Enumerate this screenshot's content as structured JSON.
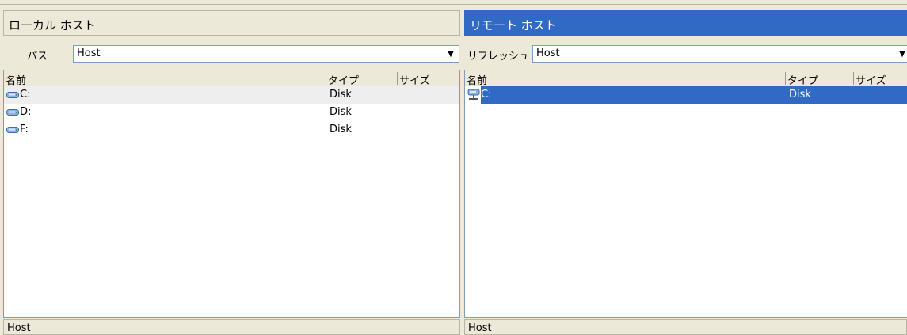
{
  "local": {
    "title": "ローカル ホスト",
    "path_label": "パス",
    "path_value": "Host",
    "columns": {
      "name": "名前",
      "type": "タイプ",
      "size": "サイズ"
    },
    "rows": [
      {
        "name": "C:",
        "type": "Disk",
        "size": ""
      },
      {
        "name": "D:",
        "type": "Disk",
        "size": ""
      },
      {
        "name": "F:",
        "type": "Disk",
        "size": ""
      }
    ],
    "status": "Host"
  },
  "remote": {
    "title": "リモート ホスト",
    "path_label": "リフレッシュ",
    "path_value": "Host",
    "columns": {
      "name": "名前",
      "type": "タイプ",
      "size": "サイズ"
    },
    "rows": [
      {
        "name": "C:",
        "type": "Disk",
        "size": ""
      }
    ],
    "status": "Host"
  },
  "colors": {
    "selection": "#316ac5",
    "panel": "#ece9d8",
    "border": "#7f9db9"
  },
  "icons": {
    "drive": "disk-drive-icon",
    "remote_drive": "network-drive-icon",
    "dropdown": "chevron-down-icon"
  }
}
